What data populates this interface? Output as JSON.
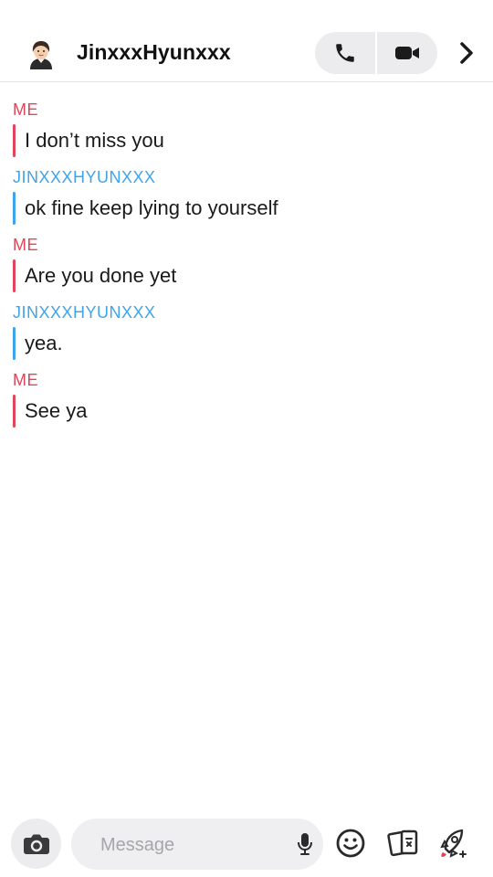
{
  "header": {
    "contact_name": "JinxxxHyunxxx",
    "icons": [
      "avatar-bitmoji",
      "phone-icon",
      "video-icon",
      "chevron-right-icon"
    ]
  },
  "messages": [
    {
      "sender": "ME",
      "side": "me",
      "text": "I don’t miss you"
    },
    {
      "sender": "JINXXXHYUNXXX",
      "side": "them",
      "text": "ok fine keep lying to yourself"
    },
    {
      "sender": "ME",
      "side": "me",
      "text": "Are you done yet"
    },
    {
      "sender": "JINXXXHYUNXXX",
      "side": "them",
      "text": "yea."
    },
    {
      "sender": "ME",
      "side": "me",
      "text": "See ya"
    }
  ],
  "composer": {
    "placeholder": "Message",
    "icons": [
      "camera-icon",
      "microphone-icon",
      "smiley-icon",
      "stickers-icon",
      "rocket-icon"
    ]
  },
  "colors": {
    "me": "#e0455a",
    "them": "#3ea4ec",
    "pill_bg": "#ececee"
  }
}
